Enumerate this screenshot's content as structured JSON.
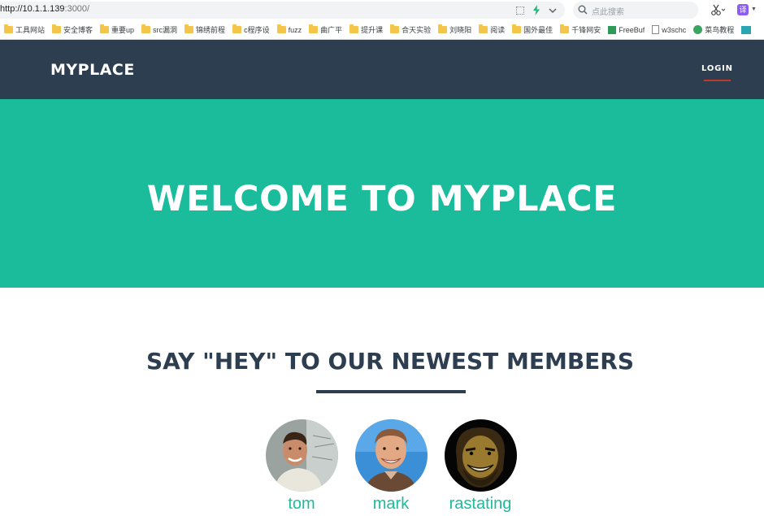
{
  "browser": {
    "url_host": "http://10.1.1.139",
    "url_rest": ":3000/",
    "search_placeholder": "点此搜索",
    "ext_label": "译",
    "bookmarks": [
      {
        "label": "工具网站",
        "icon": "folder"
      },
      {
        "label": "安全博客",
        "icon": "folder"
      },
      {
        "label": "重要up",
        "icon": "folder"
      },
      {
        "label": "src漏洞",
        "icon": "folder"
      },
      {
        "label": "锦绣前程",
        "icon": "folder"
      },
      {
        "label": "c程序设",
        "icon": "folder"
      },
      {
        "label": "fuzz",
        "icon": "folder"
      },
      {
        "label": "曲广平",
        "icon": "folder"
      },
      {
        "label": "提升课",
        "icon": "folder"
      },
      {
        "label": "合天实验",
        "icon": "folder"
      },
      {
        "label": "刘晓阳",
        "icon": "folder"
      },
      {
        "label": "阅读",
        "icon": "folder"
      },
      {
        "label": "国外最佳",
        "icon": "folder"
      },
      {
        "label": "千锋网安",
        "icon": "folder"
      },
      {
        "label": "FreeBuf",
        "icon": "freebuf"
      },
      {
        "label": "w3schc",
        "icon": "page"
      },
      {
        "label": "菜鸟教程",
        "icon": "cainiao"
      }
    ]
  },
  "navbar": {
    "brand": "MYPLACE",
    "login_label": "LOGIN"
  },
  "hero": {
    "title": "WELCOME TO MYPLACE"
  },
  "members": {
    "title": "SAY \"HEY\" TO OUR NEWEST MEMBERS",
    "list": [
      {
        "name": "tom"
      },
      {
        "name": "mark"
      },
      {
        "name": "rastating"
      }
    ]
  },
  "colors": {
    "navbar": "#2c3e50",
    "hero": "#1abc9c",
    "accent": "#1abc9c",
    "login_underline": "#c0392b"
  }
}
